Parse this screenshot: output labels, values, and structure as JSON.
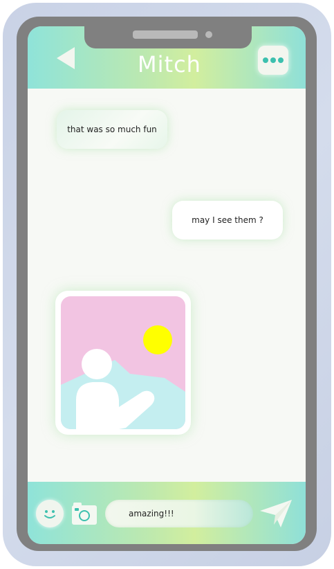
{
  "header": {
    "title": "Mitch"
  },
  "messages": [
    {
      "direction": "incoming",
      "text": "that was so much fun"
    },
    {
      "direction": "outgoing",
      "text": "may I see them ?"
    }
  ],
  "image_message": {
    "icon": "image-placeholder-icon"
  },
  "composer": {
    "input_value": "amazing!!!"
  },
  "colors": {
    "accent_teal": "#3cc0ae",
    "header_gradient_start": "#8fe3d9",
    "header_gradient_mid": "#d2ee9e",
    "photo_pink": "#f2c4e2",
    "photo_sun": "#ffff00",
    "photo_mountain": "#c4eef0"
  },
  "icons": {
    "back": "back-arrow-icon",
    "more": "more-options-icon",
    "emoji": "smiley-icon",
    "camera": "camera-icon",
    "send": "send-icon"
  }
}
